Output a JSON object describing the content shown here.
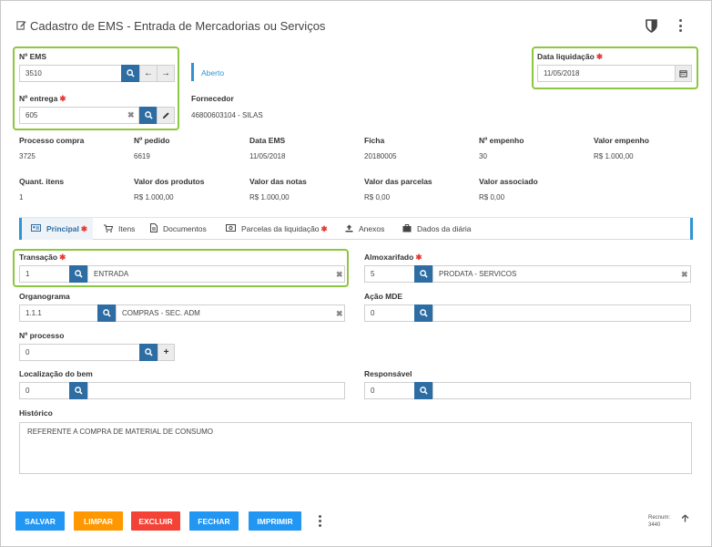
{
  "header": {
    "title": "Cadastro de EMS - Entrada de Mercadorias ou Serviços",
    "title_icon": "edit-icon",
    "shield_icon": "shield-icon",
    "more_icon": "more-vertical-icon"
  },
  "top": {
    "ems_label": "Nº EMS",
    "ems_value": "3510",
    "entrega_label": "Nº entrega",
    "entrega_value": "605",
    "status": "Aberto",
    "fornecedor_label": "Fornecedor",
    "fornecedor_value": "46800603104 - SILAS",
    "data_liq_label": "Data liquidação",
    "data_liq_value": "11/05/2018",
    "required_mark": "✱"
  },
  "info_grid": {
    "row1": [
      {
        "label": "Processo compra",
        "value": "3725"
      },
      {
        "label": "Nº pedido",
        "value": "6619"
      },
      {
        "label": "Data EMS",
        "value": "11/05/2018"
      },
      {
        "label": "Ficha",
        "value": "20180005"
      },
      {
        "label": "Nº empenho",
        "value": "30"
      },
      {
        "label": "Valor empenho",
        "value": "R$ 1.000,00"
      }
    ],
    "row2": [
      {
        "label": "Quant. itens",
        "value": "1"
      },
      {
        "label": "Valor dos produtos",
        "value": "R$ 1.000,00"
      },
      {
        "label": "Valor das notas",
        "value": "R$ 1.000,00"
      },
      {
        "label": "Valor das parcelas",
        "value": "R$ 0,00"
      },
      {
        "label": "Valor associado",
        "value": "R$ 0,00"
      }
    ]
  },
  "tabs": [
    {
      "label": "Principal",
      "icon": "id-card-icon",
      "required": true
    },
    {
      "label": "Itens",
      "icon": "cart-icon",
      "required": false
    },
    {
      "label": "Documentos",
      "icon": "document-icon",
      "required": false
    },
    {
      "label": "Parcelas da liquidação",
      "icon": "money-icon",
      "required": true
    },
    {
      "label": "Anexos",
      "icon": "upload-icon",
      "required": false
    },
    {
      "label": "Dados da diária",
      "icon": "briefcase-icon",
      "required": false
    }
  ],
  "form": {
    "transacao_label": "Transação",
    "transacao_code": "1",
    "transacao_desc": "ENTRADA",
    "almox_label": "Almoxarifado",
    "almox_code": "5",
    "almox_desc": "PRODATA - SERVICOS",
    "organograma_label": "Organograma",
    "organograma_code": "1.1.1",
    "organograma_desc": "COMPRAS - SEC. ADM",
    "acao_label": "Ação MDE",
    "acao_code": "0",
    "processo_label": "Nº processo",
    "processo_value": "0",
    "localizacao_label": "Localização do bem",
    "localizacao_code": "0",
    "responsavel_label": "Responsável",
    "responsavel_code": "0",
    "historico_label": "Histórico",
    "historico_value": "REFERENTE A COMPRA DE MATERIAL DE CONSUMO"
  },
  "footer": {
    "salvar": "SALVAR",
    "limpar": "LIMPAR",
    "excluir": "EXCLUIR",
    "fechar": "FECHAR",
    "imprimir": "IMPRIMIR",
    "recnum_label": "Recnum:",
    "recnum_value": "3440",
    "colors": {
      "salvar": "#2196f3",
      "limpar": "#ff9800",
      "excluir": "#f44336",
      "fechar": "#2196f3",
      "imprimir": "#2196f3"
    }
  }
}
